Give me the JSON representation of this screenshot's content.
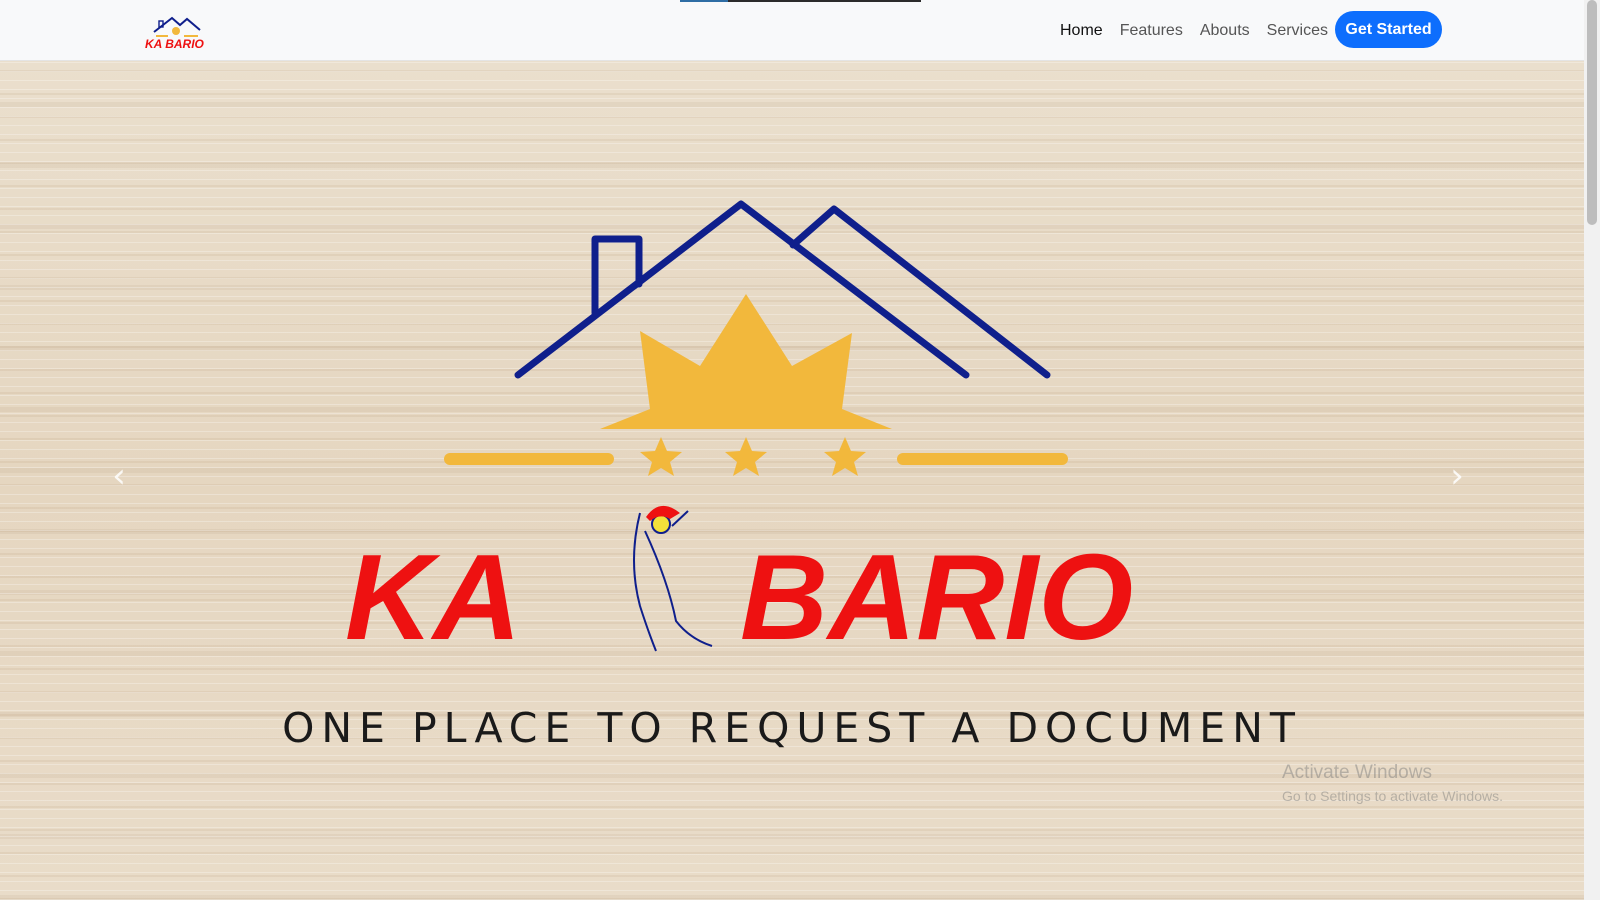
{
  "navbar": {
    "logo_text": "KA BARIO",
    "links": [
      {
        "label": "Home",
        "active": true
      },
      {
        "label": "Features",
        "active": false
      },
      {
        "label": "Abouts",
        "active": false
      },
      {
        "label": "Services",
        "active": false
      }
    ],
    "cta_label": "Get Started"
  },
  "hero": {
    "logo_text_left": "KA",
    "logo_text_right": "BARIO",
    "tagline": "ONE PLACE TO REQUEST A DOCUMENT",
    "prev_arrow": "‹",
    "next_arrow": "›"
  },
  "watermark": {
    "line1": "Activate Windows",
    "line2": "Go to Settings to activate Windows."
  },
  "colors": {
    "accent": "#0d6efd",
    "logo_blue": "#0f1f8c",
    "logo_yellow": "#f2b83c",
    "logo_red": "#ee1111"
  },
  "icons": {
    "prev": "chevron-left-icon",
    "next": "chevron-right-icon"
  }
}
